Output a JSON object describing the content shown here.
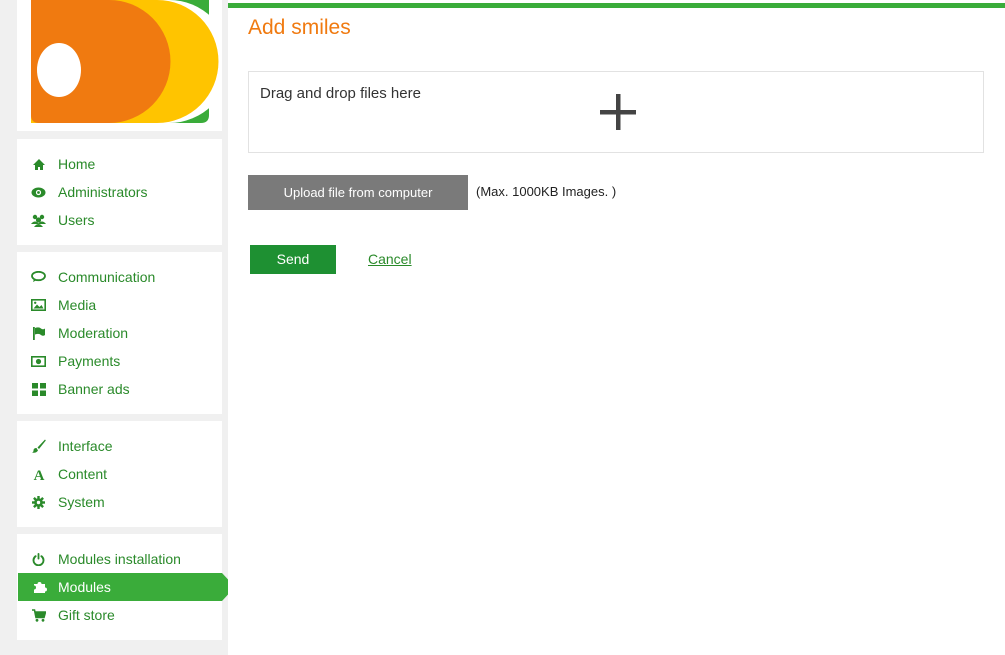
{
  "colors": {
    "accent_green": "#3aac3a",
    "link_green": "#2a8a2a",
    "title_orange": "#f07a10",
    "send_button": "#1e9032",
    "upload_button": "#7a7a7a"
  },
  "sidebar": {
    "logo_icon": "brand-logo-icon",
    "groups": [
      {
        "items": [
          {
            "label": "Home",
            "icon": "home-icon"
          },
          {
            "label": "Administrators",
            "icon": "eye-icon"
          },
          {
            "label": "Users",
            "icon": "users-icon"
          }
        ]
      },
      {
        "items": [
          {
            "label": "Communication",
            "icon": "chat-icon"
          },
          {
            "label": "Media",
            "icon": "image-icon"
          },
          {
            "label": "Moderation",
            "icon": "flag-icon"
          },
          {
            "label": "Payments",
            "icon": "money-icon"
          },
          {
            "label": "Banner ads",
            "icon": "grid-icon"
          }
        ]
      },
      {
        "items": [
          {
            "label": "Interface",
            "icon": "brush-icon"
          },
          {
            "label": "Content",
            "icon": "font-icon"
          },
          {
            "label": "System",
            "icon": "gear-icon"
          }
        ]
      },
      {
        "items": [
          {
            "label": "Modules installation",
            "icon": "power-icon"
          },
          {
            "label": "Modules",
            "icon": "puzzle-icon",
            "active": true
          },
          {
            "label": "Gift store",
            "icon": "cart-icon"
          }
        ]
      }
    ]
  },
  "main": {
    "title": "Add smiles",
    "dropzone": {
      "text": "Drag and drop files here",
      "icon": "plus-icon"
    },
    "upload_button": "Upload file from computer",
    "upload_hint": "(Max. 1000KB Images. )",
    "send_button": "Send",
    "cancel_link": "Cancel"
  }
}
